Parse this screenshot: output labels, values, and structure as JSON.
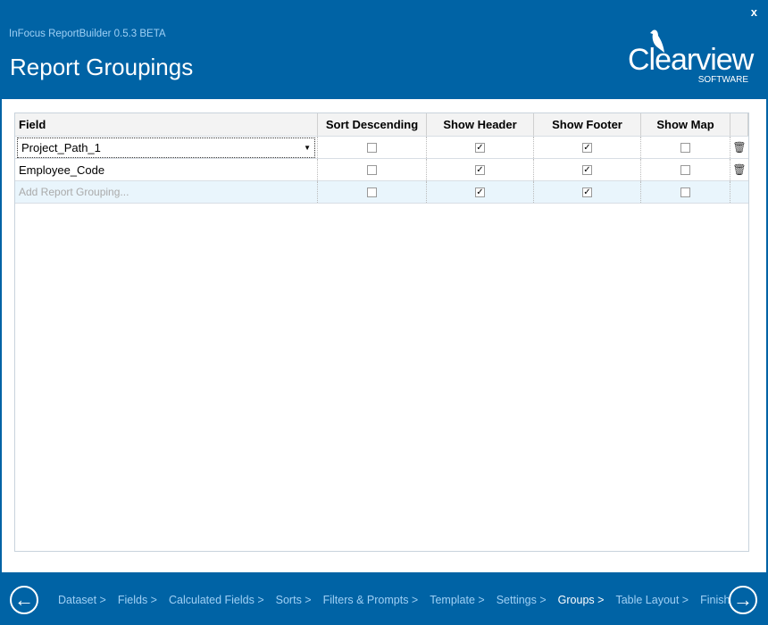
{
  "window": {
    "app_title": "InFocus ReportBuilder 0.5.3 BETA",
    "page_title": "Report Groupings",
    "close": "x"
  },
  "logo": {
    "word": "Clearview",
    "sub": "SOFTWARE"
  },
  "grid": {
    "headers": [
      "Field",
      "Sort Descending",
      "Show Header",
      "Show Footer",
      "Show Map"
    ],
    "rows": [
      {
        "field": "Project_Path_1",
        "sort_descending": false,
        "show_header": true,
        "show_footer": true,
        "show_map": false,
        "editing": true
      },
      {
        "field": "Employee_Code",
        "sort_descending": false,
        "show_header": true,
        "show_footer": true,
        "show_map": false
      }
    ],
    "add_row": {
      "placeholder": "Add Report Grouping...",
      "sort_descending": false,
      "show_header": true,
      "show_footer": true,
      "show_map": false
    }
  },
  "footer": {
    "steps": [
      "Dataset >",
      "Fields >",
      "Calculated Fields >",
      "Sorts >",
      "Filters & Prompts >",
      "Template >",
      "Settings >",
      "Groups >",
      "Table Layout >",
      "Finish"
    ],
    "active_step": "Groups >"
  },
  "colors": {
    "brand": "#0063a5",
    "add_row": "#e9f5fc"
  }
}
